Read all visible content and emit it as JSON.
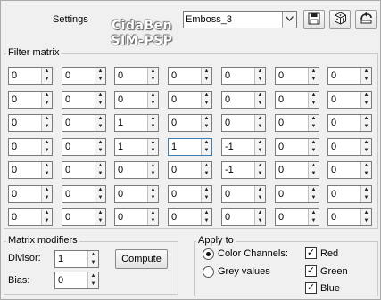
{
  "header": {
    "settings_label": "Settings",
    "watermark_line1": "CidaBen",
    "watermark_line2": "SIM-PSP",
    "preset_value": "Emboss_3",
    "dropdown_icon": "chevron-down-icon",
    "save_icon": "floppy-disk-icon",
    "random_icon": "dice-icon",
    "reset_icon": "reset-arrow-icon"
  },
  "filter_matrix": {
    "title": "Filter matrix",
    "rows": [
      [
        "0",
        "0",
        "0",
        "0",
        "0",
        "0",
        "0"
      ],
      [
        "0",
        "0",
        "0",
        "0",
        "0",
        "0",
        "0"
      ],
      [
        "0",
        "0",
        "1",
        "0",
        "0",
        "0",
        "0"
      ],
      [
        "0",
        "0",
        "1",
        "1",
        "-1",
        "0",
        "0"
      ],
      [
        "0",
        "0",
        "0",
        "0",
        "-1",
        "0",
        "0"
      ],
      [
        "0",
        "0",
        "0",
        "0",
        "0",
        "0",
        "0"
      ],
      [
        "0",
        "0",
        "0",
        "0",
        "0",
        "0",
        "0"
      ]
    ]
  },
  "matrix_modifiers": {
    "title": "Matrix modifiers",
    "divisor_label": "Divisor:",
    "divisor_value": "1",
    "bias_label": "Bias:",
    "bias_value": "0",
    "compute_label": "Compute"
  },
  "apply_to": {
    "title": "Apply to",
    "color_channels_label": "Color Channels:",
    "grey_values_label": "Grey values",
    "selected": "color_channels",
    "channels": [
      {
        "label": "Red",
        "checked": true
      },
      {
        "label": "Green",
        "checked": true
      },
      {
        "label": "Blue",
        "checked": true
      }
    ]
  }
}
